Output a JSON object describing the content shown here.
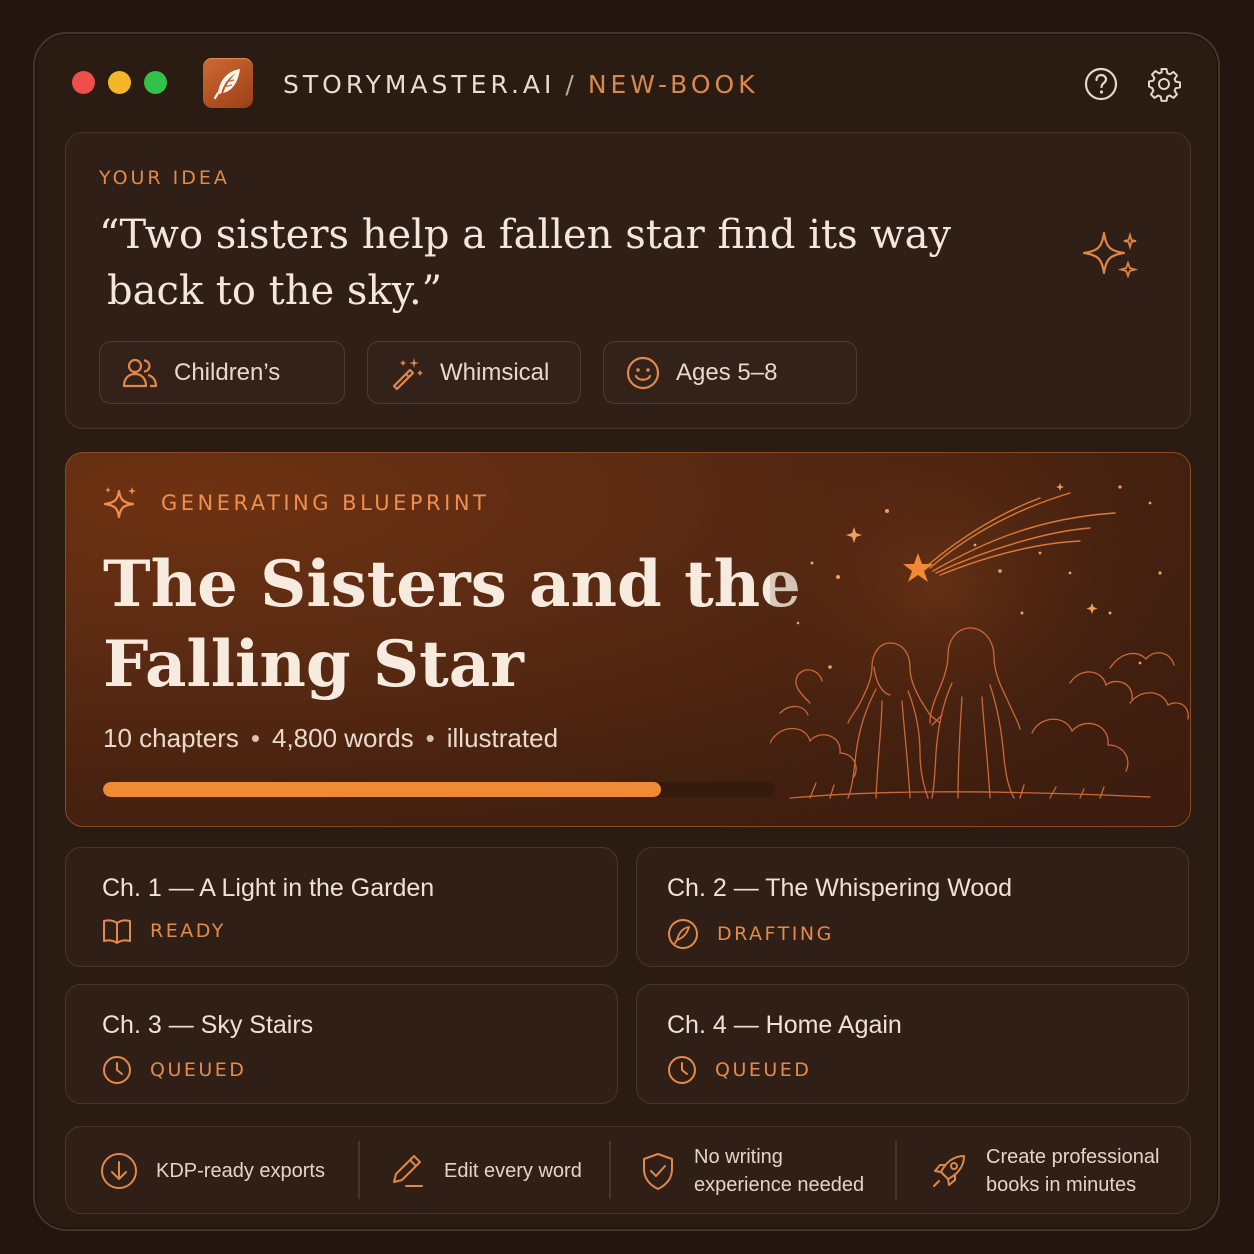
{
  "titlebar": {
    "app_name": "STORYMASTER.AI",
    "separator": "/",
    "page_name": "NEW-BOOK",
    "icons": [
      "help-icon",
      "gear-icon"
    ]
  },
  "idea": {
    "eyebrow": "YOUR IDEA",
    "quote_line1": "“Two sisters help a fallen star find its way",
    "quote_line2": "back to the sky.”",
    "chips": [
      {
        "label": "Children’s",
        "icon": "people-icon"
      },
      {
        "label": "Whimsical",
        "icon": "magic-wand-icon"
      },
      {
        "label": "Ages 5–8",
        "icon": "smiley-icon"
      }
    ]
  },
  "blueprint": {
    "eyebrow": "GENERATING BLUEPRINT",
    "title_line1": "The Sisters and the",
    "title_line2": "Falling Star",
    "meta": [
      "10 chapters",
      "4,800 words",
      "illustrated"
    ],
    "meta_separator": "•",
    "progress_percent": 83
  },
  "chapters": [
    {
      "title": "Ch. 1 — A Light in the Garden",
      "status": "READY",
      "icon": "book-icon"
    },
    {
      "title": "Ch. 2 — The Whispering Wood",
      "status": "DRAFTING",
      "icon": "quill-icon"
    },
    {
      "title": "Ch. 3 — Sky Stairs",
      "status": "QUEUED",
      "icon": "clock-icon"
    },
    {
      "title": "Ch. 4 — Home Again",
      "status": "QUEUED",
      "icon": "clock-icon"
    }
  ],
  "features": [
    {
      "line1": "KDP-ready exports",
      "line2": "",
      "icon": "download-icon"
    },
    {
      "line1": "Edit every word",
      "line2": "",
      "icon": "pencil-icon"
    },
    {
      "line1": "No writing",
      "line2": "experience needed",
      "icon": "shield-check-icon"
    },
    {
      "line1": "Create professional",
      "line2": "books in minutes",
      "icon": "rocket-icon"
    }
  ],
  "colors": {
    "accent": "#f08a34",
    "background": "#231610",
    "card": "#2f1f16"
  }
}
